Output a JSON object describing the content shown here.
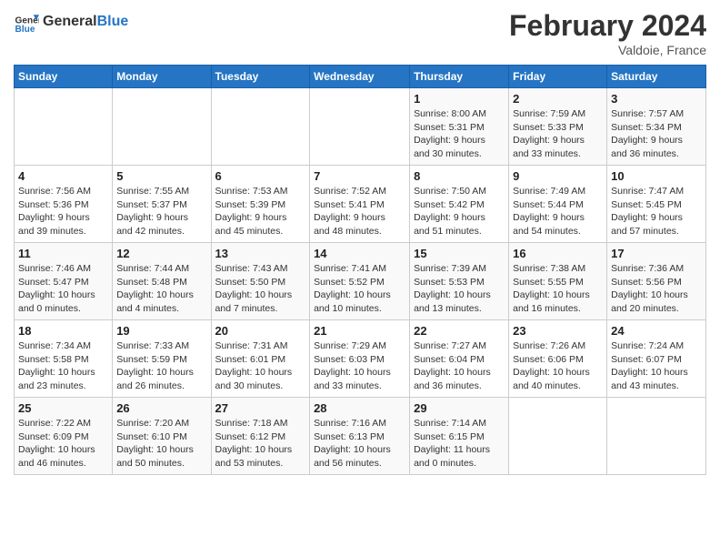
{
  "header": {
    "logo_general": "General",
    "logo_blue": "Blue",
    "title": "February 2024",
    "subtitle": "Valdoie, France"
  },
  "columns": [
    "Sunday",
    "Monday",
    "Tuesday",
    "Wednesday",
    "Thursday",
    "Friday",
    "Saturday"
  ],
  "weeks": [
    [
      {
        "num": "",
        "info": ""
      },
      {
        "num": "",
        "info": ""
      },
      {
        "num": "",
        "info": ""
      },
      {
        "num": "",
        "info": ""
      },
      {
        "num": "1",
        "info": "Sunrise: 8:00 AM\nSunset: 5:31 PM\nDaylight: 9 hours\nand 30 minutes."
      },
      {
        "num": "2",
        "info": "Sunrise: 7:59 AM\nSunset: 5:33 PM\nDaylight: 9 hours\nand 33 minutes."
      },
      {
        "num": "3",
        "info": "Sunrise: 7:57 AM\nSunset: 5:34 PM\nDaylight: 9 hours\nand 36 minutes."
      }
    ],
    [
      {
        "num": "4",
        "info": "Sunrise: 7:56 AM\nSunset: 5:36 PM\nDaylight: 9 hours\nand 39 minutes."
      },
      {
        "num": "5",
        "info": "Sunrise: 7:55 AM\nSunset: 5:37 PM\nDaylight: 9 hours\nand 42 minutes."
      },
      {
        "num": "6",
        "info": "Sunrise: 7:53 AM\nSunset: 5:39 PM\nDaylight: 9 hours\nand 45 minutes."
      },
      {
        "num": "7",
        "info": "Sunrise: 7:52 AM\nSunset: 5:41 PM\nDaylight: 9 hours\nand 48 minutes."
      },
      {
        "num": "8",
        "info": "Sunrise: 7:50 AM\nSunset: 5:42 PM\nDaylight: 9 hours\nand 51 minutes."
      },
      {
        "num": "9",
        "info": "Sunrise: 7:49 AM\nSunset: 5:44 PM\nDaylight: 9 hours\nand 54 minutes."
      },
      {
        "num": "10",
        "info": "Sunrise: 7:47 AM\nSunset: 5:45 PM\nDaylight: 9 hours\nand 57 minutes."
      }
    ],
    [
      {
        "num": "11",
        "info": "Sunrise: 7:46 AM\nSunset: 5:47 PM\nDaylight: 10 hours\nand 0 minutes."
      },
      {
        "num": "12",
        "info": "Sunrise: 7:44 AM\nSunset: 5:48 PM\nDaylight: 10 hours\nand 4 minutes."
      },
      {
        "num": "13",
        "info": "Sunrise: 7:43 AM\nSunset: 5:50 PM\nDaylight: 10 hours\nand 7 minutes."
      },
      {
        "num": "14",
        "info": "Sunrise: 7:41 AM\nSunset: 5:52 PM\nDaylight: 10 hours\nand 10 minutes."
      },
      {
        "num": "15",
        "info": "Sunrise: 7:39 AM\nSunset: 5:53 PM\nDaylight: 10 hours\nand 13 minutes."
      },
      {
        "num": "16",
        "info": "Sunrise: 7:38 AM\nSunset: 5:55 PM\nDaylight: 10 hours\nand 16 minutes."
      },
      {
        "num": "17",
        "info": "Sunrise: 7:36 AM\nSunset: 5:56 PM\nDaylight: 10 hours\nand 20 minutes."
      }
    ],
    [
      {
        "num": "18",
        "info": "Sunrise: 7:34 AM\nSunset: 5:58 PM\nDaylight: 10 hours\nand 23 minutes."
      },
      {
        "num": "19",
        "info": "Sunrise: 7:33 AM\nSunset: 5:59 PM\nDaylight: 10 hours\nand 26 minutes."
      },
      {
        "num": "20",
        "info": "Sunrise: 7:31 AM\nSunset: 6:01 PM\nDaylight: 10 hours\nand 30 minutes."
      },
      {
        "num": "21",
        "info": "Sunrise: 7:29 AM\nSunset: 6:03 PM\nDaylight: 10 hours\nand 33 minutes."
      },
      {
        "num": "22",
        "info": "Sunrise: 7:27 AM\nSunset: 6:04 PM\nDaylight: 10 hours\nand 36 minutes."
      },
      {
        "num": "23",
        "info": "Sunrise: 7:26 AM\nSunset: 6:06 PM\nDaylight: 10 hours\nand 40 minutes."
      },
      {
        "num": "24",
        "info": "Sunrise: 7:24 AM\nSunset: 6:07 PM\nDaylight: 10 hours\nand 43 minutes."
      }
    ],
    [
      {
        "num": "25",
        "info": "Sunrise: 7:22 AM\nSunset: 6:09 PM\nDaylight: 10 hours\nand 46 minutes."
      },
      {
        "num": "26",
        "info": "Sunrise: 7:20 AM\nSunset: 6:10 PM\nDaylight: 10 hours\nand 50 minutes."
      },
      {
        "num": "27",
        "info": "Sunrise: 7:18 AM\nSunset: 6:12 PM\nDaylight: 10 hours\nand 53 minutes."
      },
      {
        "num": "28",
        "info": "Sunrise: 7:16 AM\nSunset: 6:13 PM\nDaylight: 10 hours\nand 56 minutes."
      },
      {
        "num": "29",
        "info": "Sunrise: 7:14 AM\nSunset: 6:15 PM\nDaylight: 11 hours\nand 0 minutes."
      },
      {
        "num": "",
        "info": ""
      },
      {
        "num": "",
        "info": ""
      }
    ]
  ]
}
